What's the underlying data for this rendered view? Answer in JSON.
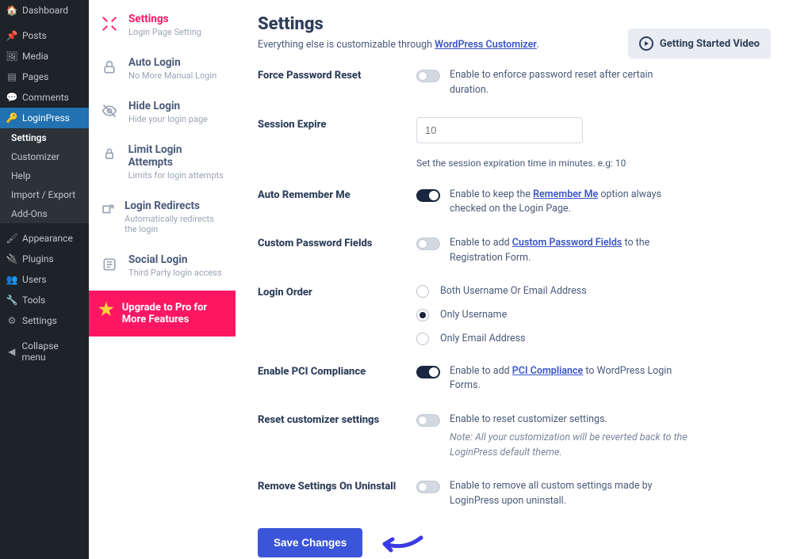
{
  "wp_sidebar": {
    "items": [
      {
        "label": "Dashboard",
        "icon": "🏠"
      },
      {
        "label": "Posts",
        "icon": "📌"
      },
      {
        "label": "Media",
        "icon": "🖼"
      },
      {
        "label": "Pages",
        "icon": "▤"
      },
      {
        "label": "Comments",
        "icon": "💬"
      },
      {
        "label": "LoginPress",
        "icon": "🔑",
        "active": true
      },
      {
        "label": "Appearance",
        "icon": "🖌"
      },
      {
        "label": "Plugins",
        "icon": "🔌"
      },
      {
        "label": "Users",
        "icon": "👥"
      },
      {
        "label": "Tools",
        "icon": "🔧"
      },
      {
        "label": "Settings",
        "icon": "⚙"
      },
      {
        "label": "Collapse menu",
        "icon": "◀"
      }
    ],
    "sub": [
      "Settings",
      "Customizer",
      "Help",
      "Import / Export",
      "Add-Ons"
    ],
    "sub_active": "Settings"
  },
  "plugin_nav": {
    "items": [
      {
        "title": "Settings",
        "sub": "Login Page Setting",
        "active": true
      },
      {
        "title": "Auto Login",
        "sub": "No More Manual Login"
      },
      {
        "title": "Hide Login",
        "sub": "Hide your login page"
      },
      {
        "title": "Limit Login Attempts",
        "sub": "Limits for login attempts"
      },
      {
        "title": "Login Redirects",
        "sub": "Automatically redirects the login"
      },
      {
        "title": "Social Login",
        "sub": "Third Party login access"
      }
    ],
    "upgrade": "Upgrade to Pro for More Features"
  },
  "content": {
    "title": "Settings",
    "intro_pre": "Everything else is customizable through ",
    "intro_link": "WordPress Customizer",
    "video_btn": "Getting Started Video",
    "save": "Save Changes",
    "rows": {
      "force_reset": {
        "label": "Force Password Reset",
        "desc": "Enable to enforce password reset after certain duration.",
        "on": false
      },
      "session": {
        "label": "Session Expire",
        "placeholder": "10",
        "hint": "Set the session expiration time in minutes. e.g: 10"
      },
      "remember": {
        "label": "Auto Remember Me",
        "pre": "Enable to keep the ",
        "link": "Remember Me",
        "post": " option always checked on the Login Page.",
        "on": true
      },
      "custom_pw": {
        "label": "Custom Password Fields",
        "pre": "Enable to add ",
        "link": "Custom Password Fields",
        "post": " to the Registration Form.",
        "on": false
      },
      "order": {
        "label": "Login Order",
        "opts": [
          "Both Username Or Email Address",
          "Only Username",
          "Only Email Address"
        ],
        "selected": 1
      },
      "pci": {
        "label": "Enable PCI Compliance",
        "pre": "Enable to add ",
        "link": "PCI Compliance",
        "post": " to WordPress Login Forms.",
        "on": true
      },
      "reset_cust": {
        "label": "Reset customizer settings",
        "desc": "Enable to reset customizer settings.",
        "note": "Note: All your customization will be reverted back to the LoginPress default theme.",
        "on": false
      },
      "remove_unin": {
        "label": "Remove Settings On Uninstall",
        "desc": "Enable to remove all custom settings made by LoginPress upon uninstall.",
        "on": false
      }
    }
  }
}
